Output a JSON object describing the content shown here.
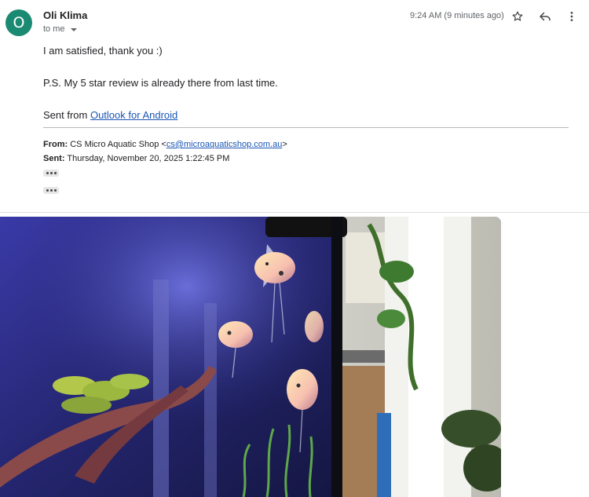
{
  "header": {
    "avatar_letter": "O",
    "sender_name": "Oli Klima",
    "recipient_label": "to me",
    "timestamp": "9:24 AM (9 minutes ago)"
  },
  "icons": [
    "star-icon",
    "reply-icon",
    "more-vert-icon",
    "chevron-down-icon",
    "ellipsis-icon"
  ],
  "message": {
    "line1": "I am satisfied, thank you :)",
    "line2": "P.S. My 5 star review is already there from last time.",
    "sent_from_prefix": "Sent from ",
    "sent_from_link": "Outlook for Android"
  },
  "quoted": {
    "from_label": "From:",
    "from_name": "CS Micro Aquatic Shop <",
    "from_email": "cs@microaquaticshop.com.au",
    "from_suffix": ">",
    "sent_label": "Sent:",
    "sent_value": "Thursday, November 20, 2025 1:22:45 PM"
  },
  "attachment": {
    "kind": "photo of an aquarium with angelfish"
  },
  "colors": {
    "avatar_bg": "#1a8a72",
    "link": "#1a55b5",
    "secondary_text": "#5f6368"
  }
}
